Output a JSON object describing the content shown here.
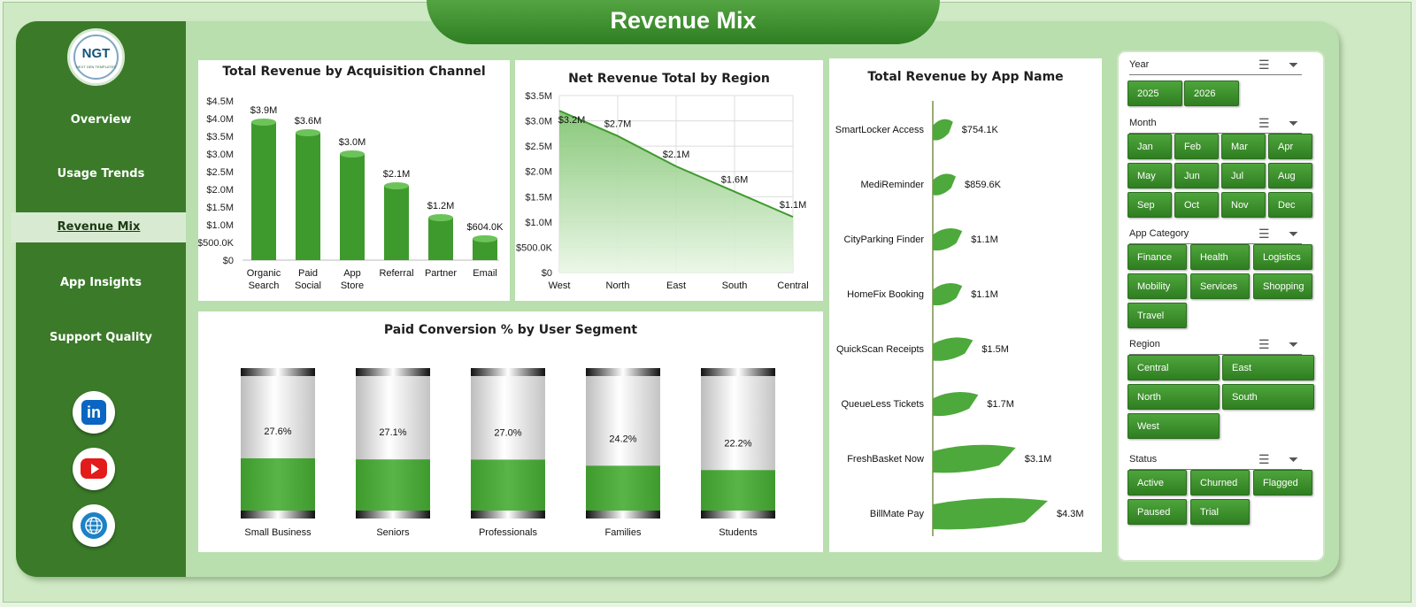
{
  "header": {
    "title": "Revenue Mix"
  },
  "sidebar": {
    "logo_text": "NGT",
    "logo_subtitle": "NEXT GEN TEMPLATES",
    "items": [
      {
        "label": "Overview",
        "active": false
      },
      {
        "label": "Usage Trends",
        "active": false
      },
      {
        "label": "Revenue Mix",
        "active": true
      },
      {
        "label": "App Insights",
        "active": false
      },
      {
        "label": "Support Quality",
        "active": false
      }
    ],
    "social": [
      "linkedin-icon",
      "youtube-icon",
      "globe-icon"
    ]
  },
  "colors": {
    "accent": "#3a7a29",
    "bar": "#3f9a2e",
    "background": "#b8dfad"
  },
  "chart_data": [
    {
      "type": "bar",
      "title": "Total Revenue  by Acquisition Channel",
      "categories": [
        "Organic Search",
        "Paid Social",
        "App Store",
        "Referral",
        "Partner",
        "Email"
      ],
      "values": [
        3.9,
        3.6,
        3.0,
        2.1,
        1.2,
        0.604
      ],
      "data_labels": [
        "$3.9M",
        "$3.6M",
        "$3.0M",
        "$2.1M",
        "$1.2M",
        "$604.0K"
      ],
      "ylim": [
        0,
        4.5
      ],
      "ytick_labels": [
        "$0",
        "$500.0K",
        "$1.0M",
        "$1.5M",
        "$2.0M",
        "$2.5M",
        "$3.0M",
        "$3.5M",
        "$4.0M",
        "$4.5M"
      ],
      "grid": false
    },
    {
      "type": "area",
      "title": "Net Revenue  Total by Region",
      "categories": [
        "West",
        "North",
        "East",
        "South",
        "Central"
      ],
      "values": [
        3.2,
        2.7,
        2.1,
        1.6,
        1.1
      ],
      "data_labels": [
        "$3.2M",
        "$2.7M",
        "$2.1M",
        "$1.6M",
        "$1.1M"
      ],
      "ylim": [
        0,
        3.5
      ],
      "ytick_labels": [
        "$0",
        "$500.0K",
        "$1.0M",
        "$1.5M",
        "$2.0M",
        "$2.5M",
        "$3.0M",
        "$3.5M"
      ],
      "grid": true
    },
    {
      "type": "bar",
      "orientation": "horizontal",
      "title": "Total Revenue  by App Name",
      "categories": [
        "SmartLocker Access",
        "MediReminder",
        "CityParking Finder",
        "HomeFix Booking",
        "QuickScan Receipts",
        "QueueLess Tickets",
        "FreshBasket Now",
        "BillMate Pay"
      ],
      "values": [
        0.7541,
        0.8596,
        1.1,
        1.1,
        1.5,
        1.7,
        3.1,
        4.3
      ],
      "data_labels": [
        "$754.1K",
        "$859.6K",
        "$1.1M",
        "$1.1M",
        "$1.5M",
        "$1.7M",
        "$3.1M",
        "$4.3M"
      ]
    },
    {
      "type": "bar",
      "title": "Paid Conversion  % by User Segment",
      "categories": [
        "Small Business",
        "Seniors",
        "Professionals",
        "Families",
        "Students"
      ],
      "values": [
        27.6,
        27.1,
        27.0,
        24.2,
        22.2
      ],
      "data_labels": [
        "27.6%",
        "27.1%",
        "27.0%",
        "24.2%",
        "22.2%"
      ],
      "ylim": [
        0,
        100
      ]
    }
  ],
  "filters": [
    {
      "label": "Year",
      "options": [
        "2025",
        "2026"
      ]
    },
    {
      "label": "Month",
      "options": [
        "Jan",
        "Feb",
        "Mar",
        "Apr",
        "May",
        "Jun",
        "Jul",
        "Aug",
        "Sep",
        "Oct",
        "Nov",
        "Dec"
      ]
    },
    {
      "label": "App Category",
      "options": [
        "Finance",
        "Health",
        "Logistics",
        "Mobility",
        "Services",
        "Shopping",
        "Travel"
      ]
    },
    {
      "label": "Region",
      "options": [
        "Central",
        "East",
        "North",
        "South",
        "West"
      ]
    },
    {
      "label": "Status",
      "options": [
        "Active",
        "Churned",
        "Flagged",
        "Paused",
        "Trial"
      ]
    }
  ]
}
